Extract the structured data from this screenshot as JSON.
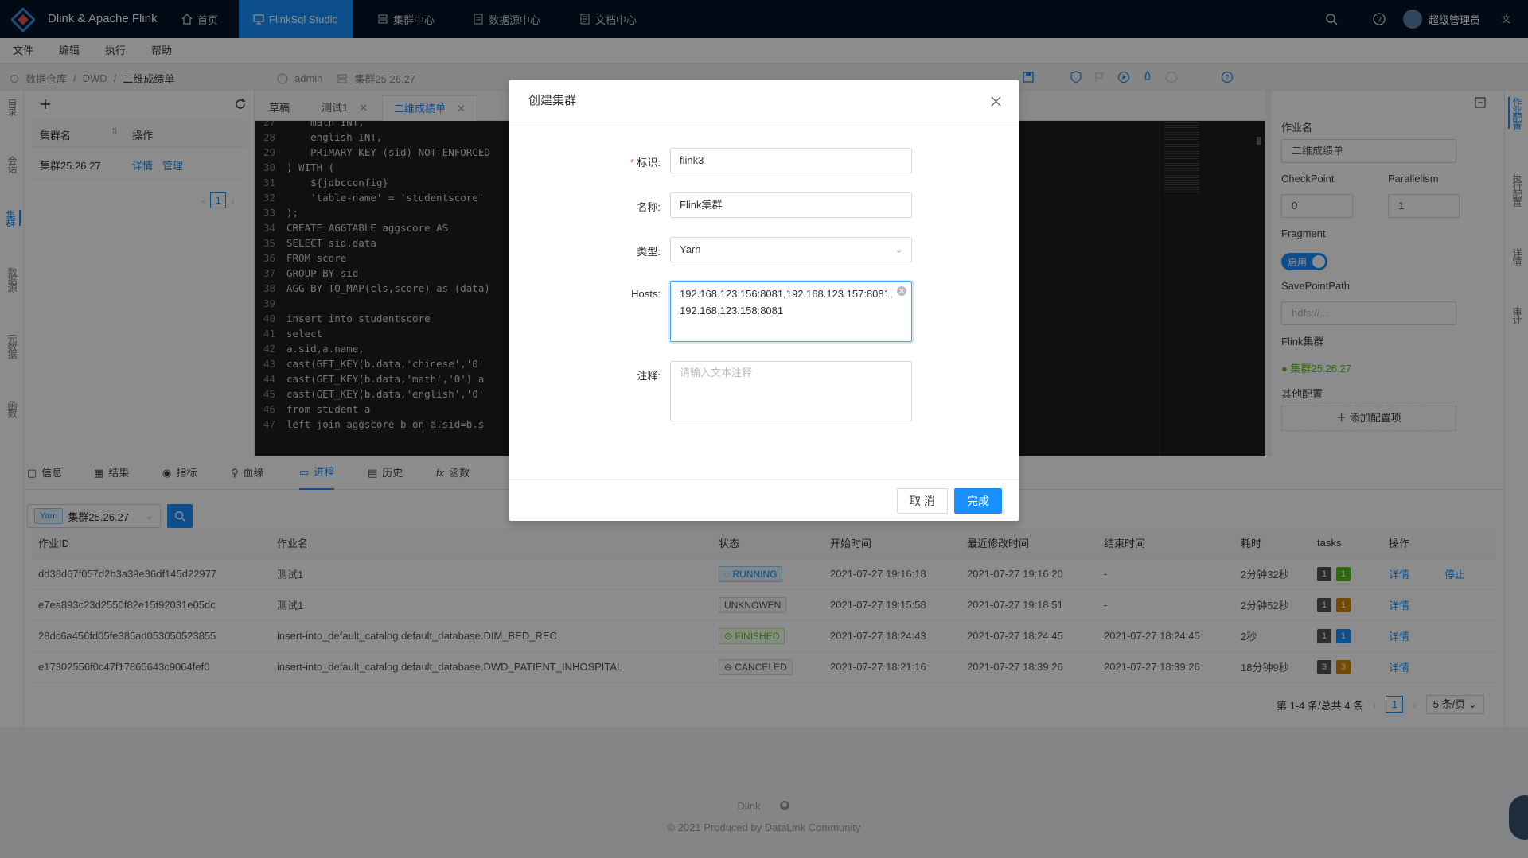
{
  "app": {
    "brand": "Dlink & Apache Flink"
  },
  "topnav": {
    "items": [
      {
        "label": "首页",
        "icon": "home-icon"
      },
      {
        "label": "FlinkSql Studio",
        "icon": "desktop-icon"
      },
      {
        "label": "集群中心",
        "icon": "cluster-icon"
      },
      {
        "label": "数据源中心",
        "icon": "database-icon"
      },
      {
        "label": "文档中心",
        "icon": "document-icon"
      }
    ],
    "user": "超级管理员"
  },
  "menubar": {
    "items": [
      "文件",
      "编辑",
      "执行",
      "帮助"
    ]
  },
  "breadcrumb": {
    "items": [
      "数据仓库",
      "DWD",
      "二维成绩单"
    ],
    "user": "admin",
    "cluster": "集群25.26.27"
  },
  "leftrail": {
    "tabs": [
      "目录",
      "会话",
      "集群",
      "数据源",
      "元数据",
      "函数"
    ]
  },
  "clusterpanel": {
    "header": {
      "name": "集群名",
      "action": "操作"
    },
    "rows": [
      {
        "name": "集群25.26.27",
        "detail": "详情",
        "manage": "管理"
      }
    ],
    "page": "1"
  },
  "editor": {
    "tabs": [
      "草稿",
      "测试1",
      "二维成绩单"
    ],
    "lines": [
      {
        "n": "27",
        "t": "    math INT,"
      },
      {
        "n": "28",
        "t": "    english INT,"
      },
      {
        "n": "29",
        "t": "    PRIMARY KEY (sid) NOT ENFORCED"
      },
      {
        "n": "30",
        "t": ") WITH ("
      },
      {
        "n": "31",
        "t": "    ${jdbcconfig}"
      },
      {
        "n": "32",
        "t": "    'table-name' = 'studentscore'"
      },
      {
        "n": "33",
        "t": ");"
      },
      {
        "n": "34",
        "t": "CREATE AGGTABLE aggscore AS"
      },
      {
        "n": "35",
        "t": "SELECT sid,data"
      },
      {
        "n": "36",
        "t": "FROM score"
      },
      {
        "n": "37",
        "t": "GROUP BY sid"
      },
      {
        "n": "38",
        "t": "AGG BY TO_MAP(cls,score) as (data)"
      },
      {
        "n": "39",
        "t": ""
      },
      {
        "n": "40",
        "t": "insert into studentscore"
      },
      {
        "n": "41",
        "t": "select"
      },
      {
        "n": "42",
        "t": "a.sid,a.name,"
      },
      {
        "n": "43",
        "t": "cast(GET_KEY(b.data,'chinese','0'"
      },
      {
        "n": "44",
        "t": "cast(GET_KEY(b.data,'math','0') a"
      },
      {
        "n": "45",
        "t": "cast(GET_KEY(b.data,'english','0'"
      },
      {
        "n": "46",
        "t": "from student a"
      },
      {
        "n": "47",
        "t": "left join aggscore b on a.sid=b.s"
      }
    ]
  },
  "rightpanel": {
    "jobname_label": "作业名",
    "jobname_value": "二维成绩单",
    "checkpoint_label": "CheckPoint",
    "checkpoint_value": "0",
    "parallelism_label": "Parallelism",
    "parallelism_value": "1",
    "fragment_label": "Fragment",
    "fragment_toggle": "启用",
    "savepoint_label": "SavePointPath",
    "savepoint_placeholder": "hdfs://...",
    "flinkcluster_label": "Flink集群",
    "flinkcluster_value": "集群25.26.27",
    "other_label": "其他配置",
    "add_config": "添加配置项"
  },
  "rightrail": {
    "tabs": [
      "作业配置",
      "执行配置",
      "详情",
      "审计"
    ]
  },
  "bottomtabs": [
    "信息",
    "结果",
    "指标",
    "血缘",
    "进程",
    "历史",
    "函数"
  ],
  "jobs": {
    "filter_tag": "Yarn",
    "filter_cluster": "集群25.26.27",
    "columns": [
      "作业ID",
      "作业名",
      "状态",
      "开始时间",
      "最近修改时间",
      "结束时间",
      "耗时",
      "tasks",
      "操作"
    ],
    "rows": [
      {
        "id": "dd38d67f057d2b3a39e36df145d22977",
        "name": "测试1",
        "status": "RUNNING",
        "start": "2021-07-27 19:16:18",
        "modified": "2021-07-27 19:16:20",
        "end": "-",
        "duration": "2分钟32秒",
        "t1": "1",
        "t2": "1",
        "t2color": "#52c41a",
        "op": "详情",
        "op2": "停止"
      },
      {
        "id": "e7ea893c23d2550f82e15f92031e05dc",
        "name": "测试1",
        "status": "UNKNOWEN",
        "start": "2021-07-27 19:15:58",
        "modified": "2021-07-27 19:18:51",
        "end": "-",
        "duration": "2分钟52秒",
        "t1": "1",
        "t2": "1",
        "t2color": "#d48806",
        "op": "详情",
        "op2": ""
      },
      {
        "id": "28dc6a456fd05fe385ad053050523855",
        "name": "insert-into_default_catalog.default_database.DIM_BED_REC",
        "status": "FINISHED",
        "start": "2021-07-27 18:24:43",
        "modified": "2021-07-27 18:24:45",
        "end": "2021-07-27 18:24:45",
        "duration": "2秒",
        "t1": "1",
        "t2": "1",
        "t2color": "#1890ff",
        "op": "详情",
        "op2": ""
      },
      {
        "id": "e17302556f0c47f17865643c9064fef0",
        "name": "insert-into_default_catalog.default_database.DWD_PATIENT_INHOSPITAL",
        "status": "CANCELED",
        "start": "2021-07-27 18:21:16",
        "modified": "2021-07-27 18:39:26",
        "end": "2021-07-27 18:39:26",
        "duration": "18分钟9秒",
        "t1": "3",
        "t2": "3",
        "t2color": "#d48806",
        "op": "详情",
        "op2": ""
      }
    ],
    "pagination": {
      "summary": "第 1-4 条/总共 4 条",
      "page": "1",
      "pagesize": "5 条/页"
    }
  },
  "footer": {
    "name": "Dlink",
    "copyright": "2021 Produced by DataLink Community"
  },
  "modal": {
    "title": "创建集群",
    "id_label": "标识:",
    "id_value": "flink3",
    "name_label": "名称:",
    "name_value": "Flink集群",
    "type_label": "类型:",
    "type_value": "Yarn",
    "hosts_label": "Hosts:",
    "hosts_value": "192.168.123.156:8081,192.168.123.157:8081,192.168.123.158:8081",
    "note_label": "注释:",
    "note_placeholder": "请输入文本注释",
    "cancel": "取 消",
    "ok": "完成"
  }
}
